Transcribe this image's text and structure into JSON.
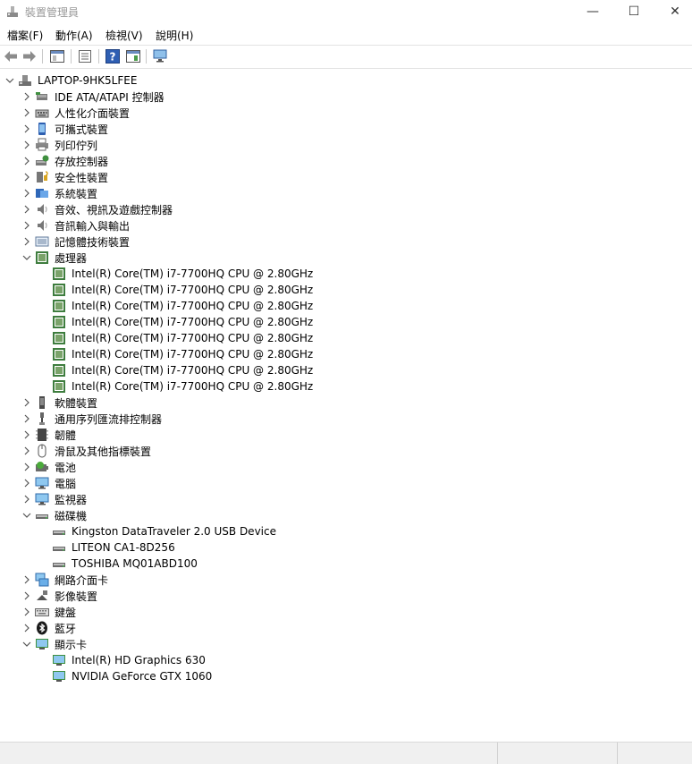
{
  "window": {
    "title": "裝置管理員",
    "min": "—",
    "max": "☐",
    "close": "✕"
  },
  "menu": [
    "檔案(F)",
    "動作(A)",
    "檢視(V)",
    "說明(H)"
  ],
  "toolbar_icons": [
    "back-arrow-icon",
    "forward-arrow-icon",
    "show-hide-console-tree-icon",
    "properties-icon",
    "help-icon",
    "action-pane-icon",
    "scan-hardware-icon"
  ],
  "tree": [
    {
      "level": 0,
      "expand": "open",
      "icon": "computer-root",
      "label": "LAPTOP-9HK5LFEE"
    },
    {
      "level": 1,
      "expand": "closed",
      "icon": "ide",
      "label": "IDE ATA/ATAPI 控制器"
    },
    {
      "level": 1,
      "expand": "closed",
      "icon": "hid",
      "label": "人性化介面裝置"
    },
    {
      "level": 1,
      "expand": "closed",
      "icon": "portable",
      "label": "可攜式裝置"
    },
    {
      "level": 1,
      "expand": "closed",
      "icon": "printer",
      "label": "列印佇列"
    },
    {
      "level": 1,
      "expand": "closed",
      "icon": "storage",
      "label": "存放控制器"
    },
    {
      "level": 1,
      "expand": "closed",
      "icon": "security",
      "label": "安全性裝置"
    },
    {
      "level": 1,
      "expand": "closed",
      "icon": "system",
      "label": "系統裝置"
    },
    {
      "level": 1,
      "expand": "closed",
      "icon": "sound",
      "label": "音效、視訊及遊戲控制器"
    },
    {
      "level": 1,
      "expand": "closed",
      "icon": "sound",
      "label": "音訊輸入與輸出"
    },
    {
      "level": 1,
      "expand": "closed",
      "icon": "memory",
      "label": "記憶體技術裝置"
    },
    {
      "level": 1,
      "expand": "open",
      "icon": "cpu",
      "label": "處理器"
    },
    {
      "level": 2,
      "expand": "none",
      "icon": "cpu",
      "label": "Intel(R) Core(TM) i7-7700HQ CPU @ 2.80GHz"
    },
    {
      "level": 2,
      "expand": "none",
      "icon": "cpu",
      "label": "Intel(R) Core(TM) i7-7700HQ CPU @ 2.80GHz"
    },
    {
      "level": 2,
      "expand": "none",
      "icon": "cpu",
      "label": "Intel(R) Core(TM) i7-7700HQ CPU @ 2.80GHz"
    },
    {
      "level": 2,
      "expand": "none",
      "icon": "cpu",
      "label": "Intel(R) Core(TM) i7-7700HQ CPU @ 2.80GHz"
    },
    {
      "level": 2,
      "expand": "none",
      "icon": "cpu",
      "label": "Intel(R) Core(TM) i7-7700HQ CPU @ 2.80GHz"
    },
    {
      "level": 2,
      "expand": "none",
      "icon": "cpu",
      "label": "Intel(R) Core(TM) i7-7700HQ CPU @ 2.80GHz"
    },
    {
      "level": 2,
      "expand": "none",
      "icon": "cpu",
      "label": "Intel(R) Core(TM) i7-7700HQ CPU @ 2.80GHz"
    },
    {
      "level": 2,
      "expand": "none",
      "icon": "cpu",
      "label": "Intel(R) Core(TM) i7-7700HQ CPU @ 2.80GHz"
    },
    {
      "level": 1,
      "expand": "closed",
      "icon": "software",
      "label": "軟體裝置"
    },
    {
      "level": 1,
      "expand": "closed",
      "icon": "usb",
      "label": "通用序列匯流排控制器"
    },
    {
      "level": 1,
      "expand": "closed",
      "icon": "firmware",
      "label": "韌體"
    },
    {
      "level": 1,
      "expand": "closed",
      "icon": "mouse",
      "label": "滑鼠及其他指標裝置"
    },
    {
      "level": 1,
      "expand": "closed",
      "icon": "battery",
      "label": "電池"
    },
    {
      "level": 1,
      "expand": "closed",
      "icon": "monitor",
      "label": "電腦"
    },
    {
      "level": 1,
      "expand": "closed",
      "icon": "monitor",
      "label": "監視器"
    },
    {
      "level": 1,
      "expand": "open",
      "icon": "disk",
      "label": "磁碟機"
    },
    {
      "level": 2,
      "expand": "none",
      "icon": "disk",
      "label": "Kingston DataTraveler 2.0 USB Device"
    },
    {
      "level": 2,
      "expand": "none",
      "icon": "disk",
      "label": "LITEON CA1-8D256"
    },
    {
      "level": 2,
      "expand": "none",
      "icon": "disk",
      "label": "TOSHIBA MQ01ABD100"
    },
    {
      "level": 1,
      "expand": "closed",
      "icon": "network",
      "label": "網路介面卡"
    },
    {
      "level": 1,
      "expand": "closed",
      "icon": "camera",
      "label": "影像裝置"
    },
    {
      "level": 1,
      "expand": "closed",
      "icon": "keyboard",
      "label": "鍵盤"
    },
    {
      "level": 1,
      "expand": "closed",
      "icon": "bluetooth",
      "label": "藍牙"
    },
    {
      "level": 1,
      "expand": "open",
      "icon": "display",
      "label": "顯示卡"
    },
    {
      "level": 2,
      "expand": "none",
      "icon": "display",
      "label": "Intel(R) HD Graphics 630"
    },
    {
      "level": 2,
      "expand": "none",
      "icon": "display",
      "label": "NVIDIA GeForce GTX 1060"
    }
  ],
  "colors": {
    "chevron": "#555555",
    "separator": "#e3e3e3",
    "statusbar": "#f0f0f0"
  }
}
